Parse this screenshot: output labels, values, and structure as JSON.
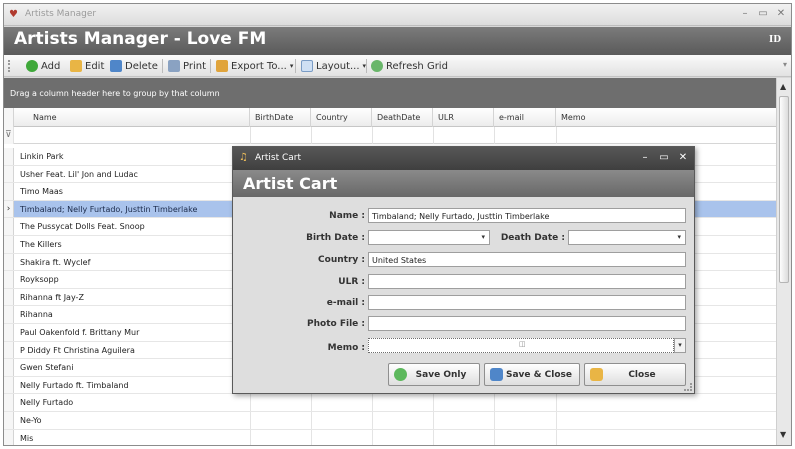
{
  "window": {
    "title": "Artists Manager",
    "banner_title": "Artists Manager - Love FM",
    "banner_right": "ID"
  },
  "toolbar": {
    "add": "Add",
    "edit": "Edit",
    "delete": "Delete",
    "print": "Print",
    "export": "Export To...",
    "layout": "Layout...",
    "refresh": "Refresh Grid"
  },
  "grid": {
    "group_hint": "Drag a column header here to group by that column",
    "columns": [
      "Name",
      "BirthDate",
      "Country",
      "DeathDate",
      "ULR",
      "e-mail",
      "Memo"
    ],
    "rows": [
      "Linkin Park",
      "Usher Feat. Lil' Jon and Ludac",
      "Timo Maas",
      "Timbaland; Nelly Furtado, Justtin Timberlake",
      "The Pussycat Dolls Feat. Snoop",
      "The Killers",
      "Shakira ft. Wyclef",
      "Royksopp",
      "Rihanna ft Jay-Z",
      "Rihanna",
      "Paul Oakenfold f. Brittany Mur",
      "P Diddy Ft Christina Aguilera",
      "Gwen Stefani",
      "Nelly Furtado ft. Timbaland",
      "Nelly Furtado",
      "Ne-Yo",
      "Mis"
    ],
    "selected_index": 3
  },
  "dialog": {
    "title": "Artist Cart",
    "banner": "Artist Cart",
    "name_label": "Name :",
    "name_value": "Timbaland; Nelly Furtado, Justtin Timberlake",
    "birth_label": "Birth Date :",
    "birth_value": "",
    "death_label": "Death Date :",
    "death_value": "",
    "country_label": "Country :",
    "country_value": "United States",
    "ulr_label": "ULR :",
    "ulr_value": "",
    "email_label": "e-mail :",
    "email_value": "",
    "photo_label": "Photo File :",
    "photo_value": "",
    "memo_label": "Memo :",
    "memo_value": "",
    "save_only": "Save Only",
    "save_close": "Save & Close",
    "close": "Close"
  },
  "colors": {
    "banner": "#5f5f5f",
    "selection": "#a9c3ec",
    "dialog_title": "#484848"
  }
}
